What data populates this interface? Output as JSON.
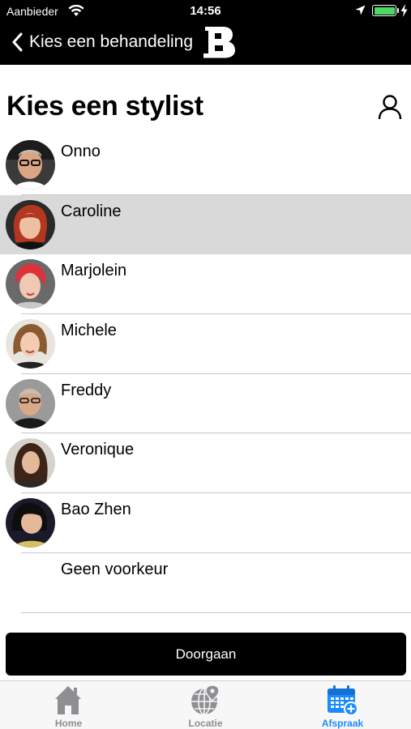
{
  "status_bar": {
    "carrier": "Aanbieder",
    "time": "14:56"
  },
  "nav": {
    "back_label": "Kies een behandeling",
    "logo_letter": "B"
  },
  "header": {
    "title": "Kies een stylist"
  },
  "stylists": [
    {
      "name": "Onno",
      "selected": false
    },
    {
      "name": "Caroline",
      "selected": true
    },
    {
      "name": "Marjolein",
      "selected": false
    },
    {
      "name": "Michele",
      "selected": false
    },
    {
      "name": "Freddy",
      "selected": false
    },
    {
      "name": "Veronique",
      "selected": false
    },
    {
      "name": "Bao Zhen",
      "selected": false
    },
    {
      "name": "Geen voorkeur",
      "selected": false
    }
  ],
  "continue_label": "Doorgaan",
  "tabs": [
    {
      "label": "Home",
      "icon": "home-icon",
      "active": false
    },
    {
      "label": "Locatie",
      "icon": "globe-icon",
      "active": false
    },
    {
      "label": "Afspraak",
      "icon": "calendar-add-icon",
      "active": true
    }
  ],
  "colors": {
    "accent": "#1a8cff",
    "selected_row": "#d9d9d9",
    "battery": "#4cd964",
    "inactive_tab": "#8e8e93"
  }
}
